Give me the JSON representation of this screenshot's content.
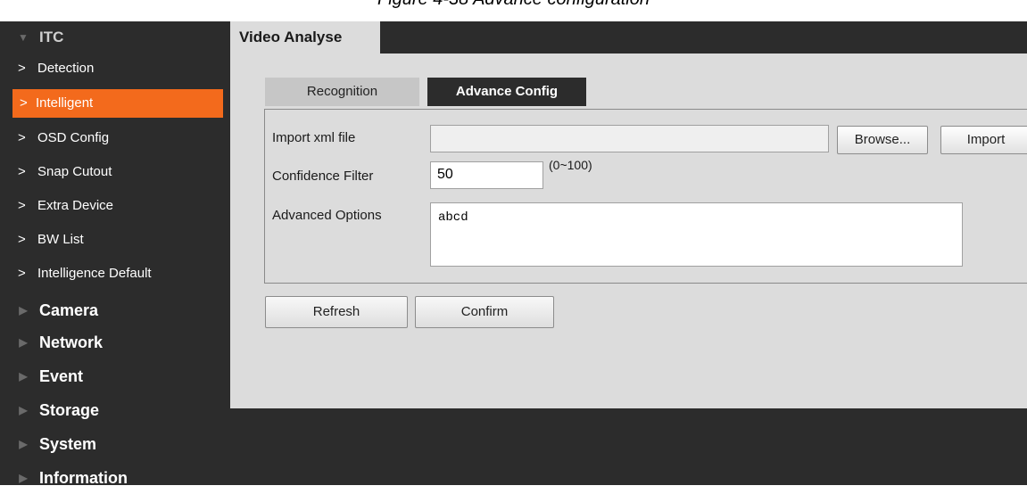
{
  "caption": "Figure 4-38 Advance configuration",
  "sidebar": {
    "open_category": "ITC",
    "items": [
      {
        "label": "Detection"
      },
      {
        "label": "Intelligent"
      },
      {
        "label": "OSD Config"
      },
      {
        "label": "Snap Cutout"
      },
      {
        "label": "Extra Device"
      },
      {
        "label": "BW List"
      },
      {
        "label": "Intelligence Default"
      }
    ],
    "active_item": "Intelligent",
    "categories": [
      {
        "label": "Camera"
      },
      {
        "label": "Network"
      },
      {
        "label": "Event"
      },
      {
        "label": "Storage"
      },
      {
        "label": "System"
      },
      {
        "label": "Information"
      }
    ]
  },
  "main": {
    "tab": "Video Analyse",
    "subtabs": [
      {
        "label": "Recognition"
      },
      {
        "label": "Advance Config"
      }
    ],
    "active_subtab": "Advance Config",
    "import": {
      "label": "Import xml file",
      "value": "",
      "browse": "Browse...",
      "import_btn": "Import"
    },
    "confidence": {
      "label": "Confidence Filter",
      "value": "50",
      "range": "(0~100)"
    },
    "advanced": {
      "label": "Advanced Options",
      "value": "abcd"
    },
    "buttons": {
      "refresh": "Refresh",
      "confirm": "Confirm"
    }
  },
  "colors": {
    "accent": "#f36a1c",
    "sidebar_bg": "#2c2c2c",
    "content_bg": "#dcdcdc"
  },
  "icons": {
    "category_open": "triangle-down-icon",
    "category_closed": "triangle-right-icon",
    "item": "chevron-right-icon"
  }
}
